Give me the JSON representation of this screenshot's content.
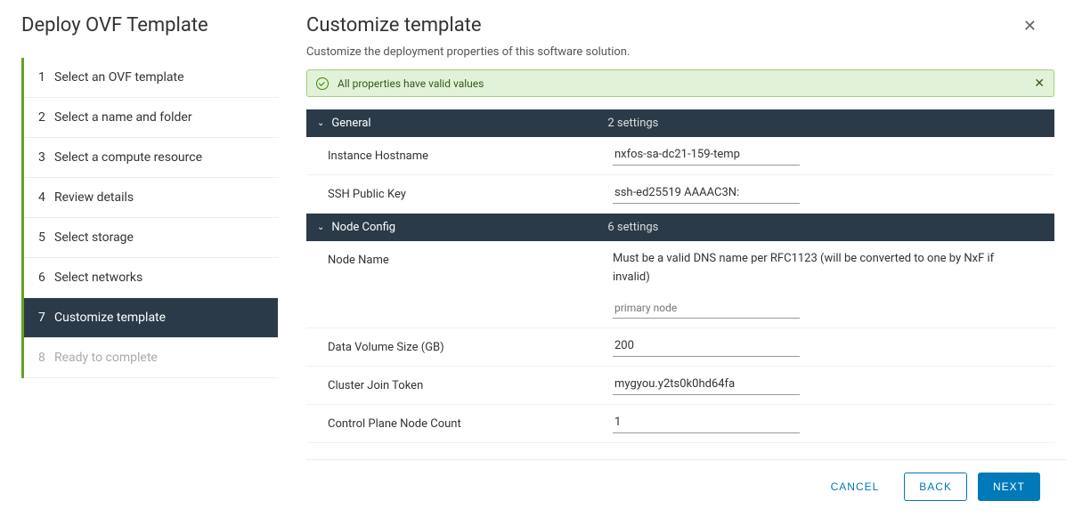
{
  "sidebar": {
    "title": "Deploy OVF Template",
    "steps": [
      {
        "num": "1",
        "label": "Select an OVF template"
      },
      {
        "num": "2",
        "label": "Select a name and folder"
      },
      {
        "num": "3",
        "label": "Select a compute resource"
      },
      {
        "num": "4",
        "label": "Review details"
      },
      {
        "num": "5",
        "label": "Select storage"
      },
      {
        "num": "6",
        "label": "Select networks"
      },
      {
        "num": "7",
        "label": "Customize template"
      },
      {
        "num": "8",
        "label": "Ready to complete"
      }
    ]
  },
  "header": {
    "title": "Customize template",
    "subtitle": "Customize the deployment properties of this software solution."
  },
  "banner": {
    "message": "All properties have valid values"
  },
  "sections": [
    {
      "title": "General",
      "count": "2 settings",
      "properties": [
        {
          "label": "Instance Hostname",
          "value": "nxfos-sa-dc21-159-temp"
        },
        {
          "label": "SSH Public Key",
          "value": "ssh-ed25519 AAAAC3N:"
        }
      ]
    },
    {
      "title": "Node Config",
      "count": "6 settings",
      "properties": [
        {
          "label": "Node Name",
          "desc": "Must be a valid DNS name per RFC1123 (will be converted to one by NxF if invalid)",
          "placeholder": "primary node"
        },
        {
          "label": "Data Volume Size (GB)",
          "value": "200"
        },
        {
          "label": "Cluster Join Token",
          "value": "mygyou.y2ts0k0hd64fa"
        },
        {
          "label": "Control Plane Node Count",
          "value": "1"
        }
      ]
    }
  ],
  "footer": {
    "cancel": "CANCEL",
    "back": "BACK",
    "next": "NEXT"
  }
}
